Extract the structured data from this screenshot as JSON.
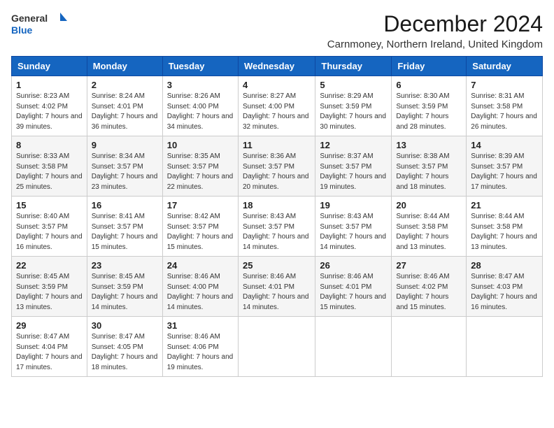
{
  "header": {
    "logo_line1": "General",
    "logo_line2": "Blue",
    "title": "December 2024",
    "subtitle": "Carnmoney, Northern Ireland, United Kingdom"
  },
  "columns": [
    "Sunday",
    "Monday",
    "Tuesday",
    "Wednesday",
    "Thursday",
    "Friday",
    "Saturday"
  ],
  "weeks": [
    [
      {
        "day": "1",
        "info": "Sunrise: 8:23 AM\nSunset: 4:02 PM\nDaylight: 7 hours and 39 minutes."
      },
      {
        "day": "2",
        "info": "Sunrise: 8:24 AM\nSunset: 4:01 PM\nDaylight: 7 hours and 36 minutes."
      },
      {
        "day": "3",
        "info": "Sunrise: 8:26 AM\nSunset: 4:00 PM\nDaylight: 7 hours and 34 minutes."
      },
      {
        "day": "4",
        "info": "Sunrise: 8:27 AM\nSunset: 4:00 PM\nDaylight: 7 hours and 32 minutes."
      },
      {
        "day": "5",
        "info": "Sunrise: 8:29 AM\nSunset: 3:59 PM\nDaylight: 7 hours and 30 minutes."
      },
      {
        "day": "6",
        "info": "Sunrise: 8:30 AM\nSunset: 3:59 PM\nDaylight: 7 hours and 28 minutes."
      },
      {
        "day": "7",
        "info": "Sunrise: 8:31 AM\nSunset: 3:58 PM\nDaylight: 7 hours and 26 minutes."
      }
    ],
    [
      {
        "day": "8",
        "info": "Sunrise: 8:33 AM\nSunset: 3:58 PM\nDaylight: 7 hours and 25 minutes."
      },
      {
        "day": "9",
        "info": "Sunrise: 8:34 AM\nSunset: 3:57 PM\nDaylight: 7 hours and 23 minutes."
      },
      {
        "day": "10",
        "info": "Sunrise: 8:35 AM\nSunset: 3:57 PM\nDaylight: 7 hours and 22 minutes."
      },
      {
        "day": "11",
        "info": "Sunrise: 8:36 AM\nSunset: 3:57 PM\nDaylight: 7 hours and 20 minutes."
      },
      {
        "day": "12",
        "info": "Sunrise: 8:37 AM\nSunset: 3:57 PM\nDaylight: 7 hours and 19 minutes."
      },
      {
        "day": "13",
        "info": "Sunrise: 8:38 AM\nSunset: 3:57 PM\nDaylight: 7 hours and 18 minutes."
      },
      {
        "day": "14",
        "info": "Sunrise: 8:39 AM\nSunset: 3:57 PM\nDaylight: 7 hours and 17 minutes."
      }
    ],
    [
      {
        "day": "15",
        "info": "Sunrise: 8:40 AM\nSunset: 3:57 PM\nDaylight: 7 hours and 16 minutes."
      },
      {
        "day": "16",
        "info": "Sunrise: 8:41 AM\nSunset: 3:57 PM\nDaylight: 7 hours and 15 minutes."
      },
      {
        "day": "17",
        "info": "Sunrise: 8:42 AM\nSunset: 3:57 PM\nDaylight: 7 hours and 15 minutes."
      },
      {
        "day": "18",
        "info": "Sunrise: 8:43 AM\nSunset: 3:57 PM\nDaylight: 7 hours and 14 minutes."
      },
      {
        "day": "19",
        "info": "Sunrise: 8:43 AM\nSunset: 3:57 PM\nDaylight: 7 hours and 14 minutes."
      },
      {
        "day": "20",
        "info": "Sunrise: 8:44 AM\nSunset: 3:58 PM\nDaylight: 7 hours and 13 minutes."
      },
      {
        "day": "21",
        "info": "Sunrise: 8:44 AM\nSunset: 3:58 PM\nDaylight: 7 hours and 13 minutes."
      }
    ],
    [
      {
        "day": "22",
        "info": "Sunrise: 8:45 AM\nSunset: 3:59 PM\nDaylight: 7 hours and 13 minutes."
      },
      {
        "day": "23",
        "info": "Sunrise: 8:45 AM\nSunset: 3:59 PM\nDaylight: 7 hours and 14 minutes."
      },
      {
        "day": "24",
        "info": "Sunrise: 8:46 AM\nSunset: 4:00 PM\nDaylight: 7 hours and 14 minutes."
      },
      {
        "day": "25",
        "info": "Sunrise: 8:46 AM\nSunset: 4:01 PM\nDaylight: 7 hours and 14 minutes."
      },
      {
        "day": "26",
        "info": "Sunrise: 8:46 AM\nSunset: 4:01 PM\nDaylight: 7 hours and 15 minutes."
      },
      {
        "day": "27",
        "info": "Sunrise: 8:46 AM\nSunset: 4:02 PM\nDaylight: 7 hours and 15 minutes."
      },
      {
        "day": "28",
        "info": "Sunrise: 8:47 AM\nSunset: 4:03 PM\nDaylight: 7 hours and 16 minutes."
      }
    ],
    [
      {
        "day": "29",
        "info": "Sunrise: 8:47 AM\nSunset: 4:04 PM\nDaylight: 7 hours and 17 minutes."
      },
      {
        "day": "30",
        "info": "Sunrise: 8:47 AM\nSunset: 4:05 PM\nDaylight: 7 hours and 18 minutes."
      },
      {
        "day": "31",
        "info": "Sunrise: 8:46 AM\nSunset: 4:06 PM\nDaylight: 7 hours and 19 minutes."
      },
      null,
      null,
      null,
      null
    ]
  ]
}
